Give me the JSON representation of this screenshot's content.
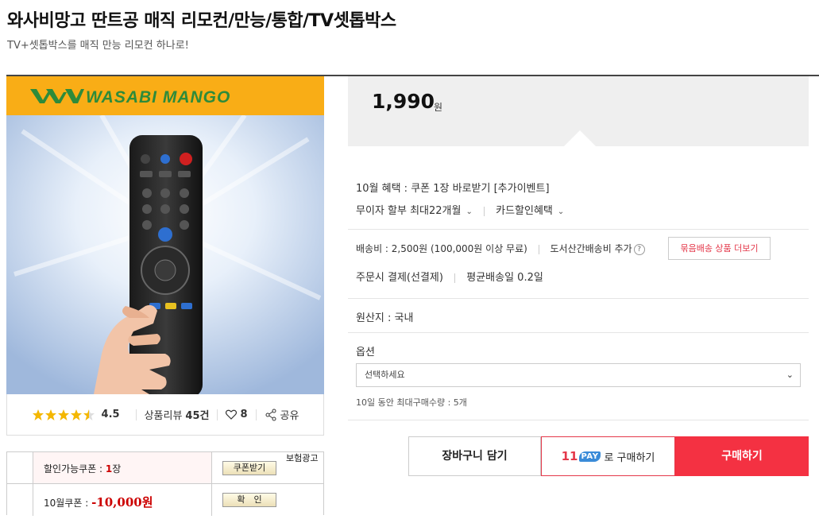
{
  "header": {
    "title": "와사비망고 딴트공 매직 리모컨/만능/통합/TV셋톱박스",
    "subtitle": "TV+셋톱박스를 매직 만능 리모컨 하나로!"
  },
  "product_image": {
    "brand": "WASABI MANGO",
    "description_icon": "remote-control-photo"
  },
  "rating": {
    "stars": 4.5,
    "score_text": "4.5",
    "review_label": "상품리뷰",
    "review_count": "45건",
    "wish_count": "8",
    "share_label": "공유"
  },
  "coupons": {
    "ad_label": "보험광고",
    "row1": {
      "prefix": "할인가능쿠폰 : ",
      "count": "1",
      "suffix": "장",
      "button": "쿠폰받기"
    },
    "row2": {
      "prefix": "10월쿠폰 : ",
      "amount": "-10,000원",
      "button": "확　인"
    }
  },
  "price": {
    "value": "1,990",
    "unit": "원"
  },
  "benefits": {
    "coupon": "10월 혜택 : 쿠폰 1장 바로받기 [추가이벤트]",
    "installment": "무이자 할부 최대22개월",
    "card": "카드할인혜택"
  },
  "shipping": {
    "fee": "배송비 : 2,500원 (100,000원 이상 무료)",
    "island_fee": "도서산간배송비 추가",
    "bundle_button": "묶음배송 상품 더보기",
    "payment": "주문시 결제(선결제)",
    "avg_delivery": "평균배송일 0.2일"
  },
  "origin": "원산지 : 국내",
  "options": {
    "label": "옵션",
    "select_placeholder": "선택하세요",
    "max_purchase": "10일 동안 최대구매수량 : 5개"
  },
  "actions": {
    "cart": "장바구니 담기",
    "pay_11": "11",
    "pay_word": "PAY",
    "pay_suffix": "로 구매하기",
    "buy": "구매하기"
  },
  "colors": {
    "accent_red": "#f43142",
    "brand_orange": "#f9ad16",
    "brand_green": "#2e8b3a"
  }
}
